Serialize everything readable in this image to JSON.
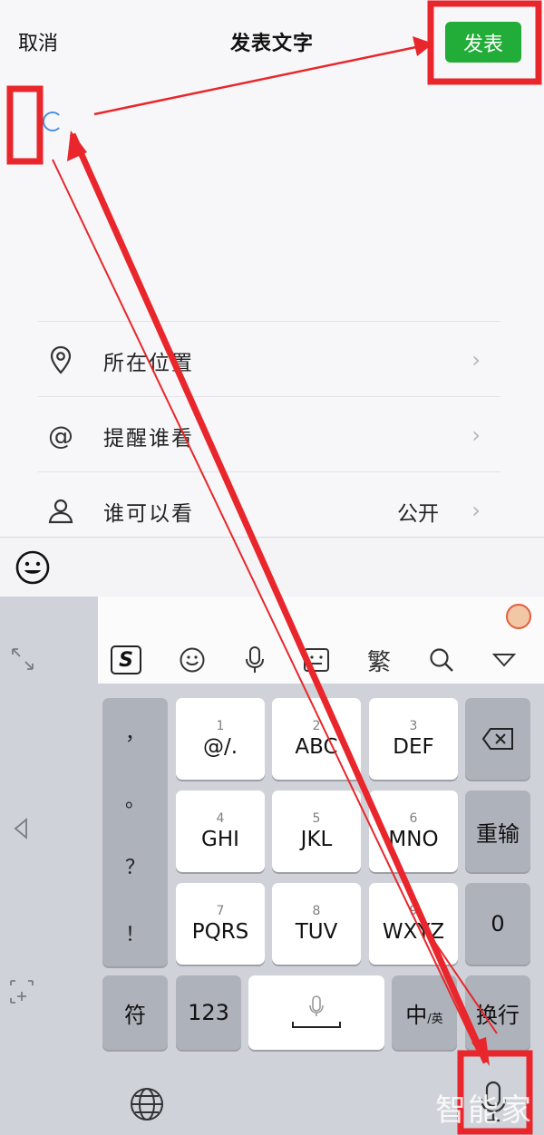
{
  "header": {
    "cancel_label": "取消",
    "title": "发表文字",
    "publish_label": "发表"
  },
  "options": [
    {
      "icon": "location-pin-icon",
      "label": "所在位置",
      "value": ""
    },
    {
      "icon": "at-icon",
      "label": "提醒谁看",
      "value": ""
    },
    {
      "icon": "person-icon",
      "label": "谁可以看",
      "value": "公开"
    }
  ],
  "keyboard": {
    "toolbar_traditional": "繁",
    "punctuation": [
      "，",
      "。",
      "？",
      "！"
    ],
    "keys": [
      {
        "num": "1",
        "label": "@/."
      },
      {
        "num": "2",
        "label": "ABC"
      },
      {
        "num": "3",
        "label": "DEF"
      },
      {
        "num": "4",
        "label": "GHI"
      },
      {
        "num": "5",
        "label": "JKL"
      },
      {
        "num": "6",
        "label": "MNO"
      },
      {
        "num": "7",
        "label": "PQRS"
      },
      {
        "num": "8",
        "label": "TUV"
      },
      {
        "num": "9",
        "label": "WXYZ"
      }
    ],
    "reenter_label": "重输",
    "zero_label": "0",
    "symbol_label": "符",
    "numeric_label": "123",
    "lang_label": "中",
    "lang_sub": "/英",
    "newline_label": "换行"
  },
  "watermark": "智能家",
  "colors": {
    "accent": "#22ac38",
    "annotation": "#e8262b"
  }
}
